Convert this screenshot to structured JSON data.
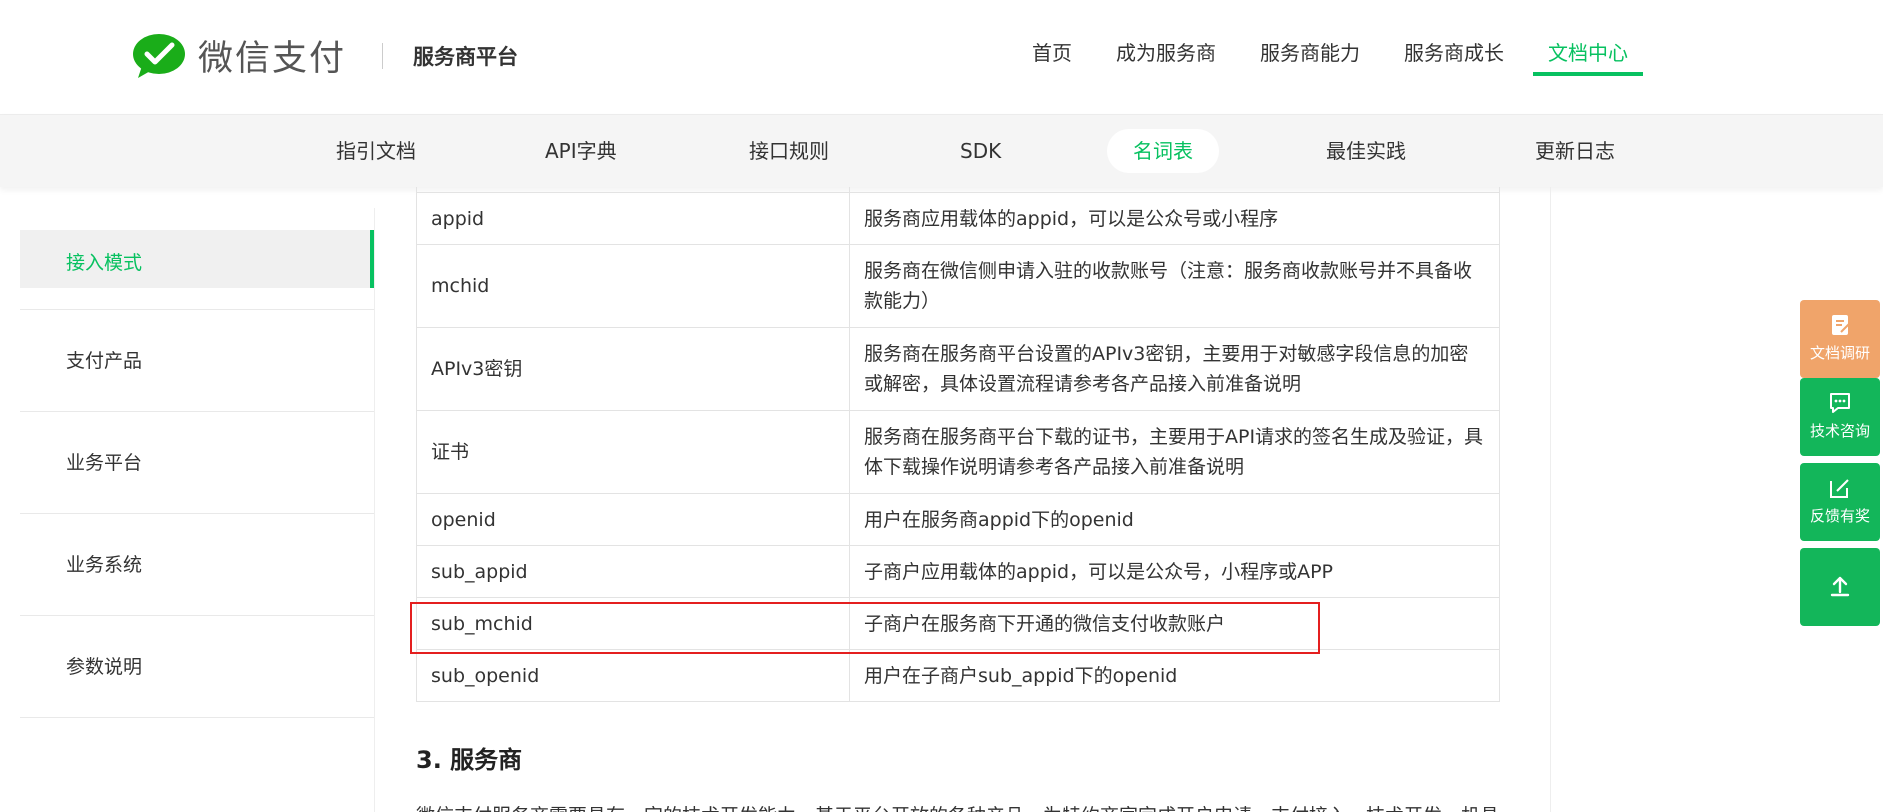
{
  "header": {
    "brand": "微信支付",
    "platform": "服务商平台",
    "nav": [
      "首页",
      "成为服务商",
      "服务商能力",
      "服务商成长",
      "文档中心"
    ],
    "active_nav": "文档中心"
  },
  "subnav": {
    "items": [
      "指引文档",
      "API字典",
      "接口规则",
      "SDK",
      "名词表",
      "最佳实践",
      "更新日志"
    ],
    "active": "名词表"
  },
  "sidebar": {
    "items": [
      "接入模式",
      "支付产品",
      "业务平台",
      "业务系统",
      "参数说明"
    ],
    "active": "接入模式"
  },
  "glossary": {
    "rows": [
      {
        "term": "appid",
        "desc": "服务商应用载体的appid，可以是公众号或小程序"
      },
      {
        "term": "mchid",
        "desc": "服务商在微信侧申请入驻的收款账号（注意：服务商收款账号并不具备收款能力）"
      },
      {
        "term": "APIv3密钥",
        "desc": "服务商在服务商平台设置的APIv3密钥，主要用于对敏感字段信息的加密或解密，具体设置流程请参考各产品接入前准备说明"
      },
      {
        "term": "证书",
        "desc": "服务商在服务商平台下载的证书，主要用于API请求的签名生成及验证，具体下载操作说明请参考各产品接入前准备说明"
      },
      {
        "term": "openid",
        "desc": "用户在服务商appid下的openid"
      },
      {
        "term": "sub_appid",
        "desc": "子商户应用载体的appid，可以是公众号，小程序或APP"
      },
      {
        "term": "sub_mchid",
        "desc": "子商户在服务商下开通的微信支付收款账户"
      },
      {
        "term": "sub_openid",
        "desc": "用户在子商户sub_appid下的openid"
      }
    ]
  },
  "section": {
    "title": "3. 服务商",
    "text": "微信支付服务商需要具有一定的技术开发能力，基于平台开放的各种产品，为特约商家完成开户申请、支付接入、技术开发、机具"
  },
  "tools": {
    "survey": "文档调研",
    "consult": "技术咨询",
    "feedback": "反馈有奖"
  },
  "colors": {
    "brand_green": "#07c160",
    "highlight_red": "#e41f1f",
    "survey_orange": "#f0a46a"
  }
}
